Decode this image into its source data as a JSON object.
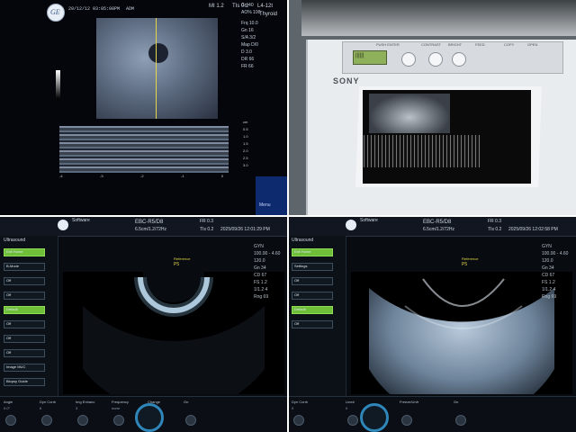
{
  "q1": {
    "header_date": "29/12/12 03:05:08PM",
    "header_mode": "ADM",
    "mi": "MI 1.2",
    "tis": "TIs 0.2",
    "probe": "L4-12t",
    "preset": "Thyroid",
    "params": [
      "Frq 10.0",
      "Gn 16",
      "S/A 3/2",
      "Map D/0",
      "D 3.0",
      "DR 66",
      "FR 66"
    ],
    "top_values": [
      "Gn 40",
      "AO% 100"
    ],
    "scale_unit": "cm",
    "mmode_depths": [
      "0.5",
      "1.0",
      "1.5",
      "2.0",
      "2.5",
      "3.0"
    ],
    "mmode_times": [
      "-4",
      "-3",
      "-2",
      "-1",
      "0"
    ],
    "menu_label": "Menu"
  },
  "q2": {
    "brand": "SONY",
    "panel_labels": [
      "PUSH ENTER",
      "CONTRAST",
      "BRIGHT",
      "FEED",
      "COPY",
      "OPEN"
    ],
    "lcd_text": "||||||"
  },
  "q3": {
    "software": "Software",
    "title": "EBC-R5/D8",
    "fr": "FR 0.3",
    "mi": "MI 0.5",
    "probe": "6.5cm/1.2/72Hz",
    "tis": "TIs 0.2",
    "datetime": "2025/09/26 12:01:29 PM",
    "focus_label": "Reference",
    "focus_value": "P5",
    "side_title": "Ultrasound",
    "side_items": [
      "Exit Home",
      "B-Mode",
      "Off",
      "Off",
      "Default",
      "Off",
      "Off",
      "Off",
      "Image MUC",
      "Biopsy Guide"
    ],
    "right_info": [
      "GYN",
      "100.00 - 4.60",
      "120.0",
      "Gn 34",
      "CD 67",
      "FS 1.2",
      "1/1.2 4",
      "Rng 69"
    ],
    "bottom": [
      "Angle",
      "Dyn Contr",
      "Img Enhanc",
      "Frequency",
      "Change",
      "Gn"
    ],
    "bottom_vals": [
      "0.0°",
      "6",
      "3",
      "norm"
    ]
  },
  "q4": {
    "software": "Software",
    "title": "EBC-R5/D8",
    "fr": "FR 0.3",
    "mi": "MI 0.5",
    "probe": "6.5cm/1.2/72Hz",
    "tis": "TIs 0.2",
    "datetime": "2025/09/26 12:02:58 PM",
    "focus_label": "Reference",
    "focus_value": "P5",
    "side_title": "Ultrasound",
    "side_items": [
      "Exit Home",
      "Settings",
      "Off",
      "Off",
      "Default",
      "Off"
    ],
    "right_info": [
      "GYN",
      "100.00 - 4.60",
      "120.0",
      "Gn 34",
      "CD 67",
      "FS 1.2",
      "1/1.2 4",
      "Rng 69"
    ],
    "bottom": [
      "Dyn Contr",
      "Line#",
      "Freeze/Unfr",
      "Gn"
    ],
    "bottom_vals": [
      "0",
      "0"
    ]
  },
  "colors": {
    "accent_blue": "#2f86b9",
    "accent_green": "#6fbe3a",
    "highlight_yellow": "#e3d64a"
  }
}
